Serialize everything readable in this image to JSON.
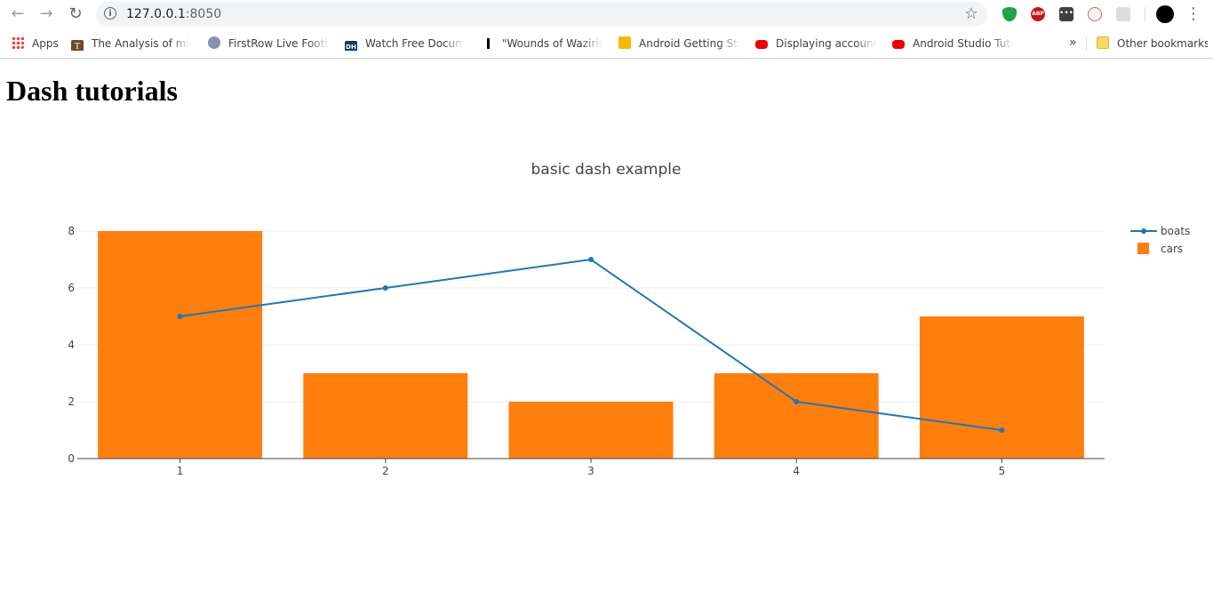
{
  "browser": {
    "url_host": "127.0.0.1",
    "url_port": ":8050",
    "icons": [
      "back-arrow-icon",
      "forward-arrow-icon",
      "reload-icon",
      "info-icon",
      "star-icon",
      "menu-dots-icon"
    ]
  },
  "bookmarks": [
    {
      "label": "Apps",
      "icon": "apps-grid-icon"
    },
    {
      "label": "The Analysis of mind,",
      "icon": "t-logo-icon"
    },
    {
      "label": "FirstRow Live Footbal",
      "icon": "firstrow-icon"
    },
    {
      "label": "Watch Free Documen",
      "icon": "dh-icon",
      "icon_text": "DH"
    },
    {
      "label": "\"Wounds of Wazirista",
      "icon": "statue-icon"
    },
    {
      "label": "Android Getting Start",
      "icon": "android-icon"
    },
    {
      "label": "Displaying account d",
      "icon": "youtube-icon"
    },
    {
      "label": "Android Studio Tutor",
      "icon": "youtube-icon"
    }
  ],
  "bookmarks_overflow": "»",
  "other_bookmarks": "Other bookmarks",
  "page": {
    "title": "Dash tutorials"
  },
  "chart_data": {
    "type": "bar",
    "title": "basic dash example",
    "x": [
      1,
      2,
      3,
      4,
      5
    ],
    "series": [
      {
        "name": "boats",
        "type": "line",
        "color": "#1f77b4",
        "values": [
          5,
          6,
          7,
          2,
          1
        ]
      },
      {
        "name": "cars",
        "type": "bar",
        "color": "#ff7f0e",
        "values": [
          8,
          3,
          2,
          3,
          5
        ]
      }
    ],
    "ylim": [
      0,
      8
    ],
    "yticks": [
      0,
      2,
      4,
      6,
      8
    ],
    "grid": true,
    "legend": "top-right"
  }
}
